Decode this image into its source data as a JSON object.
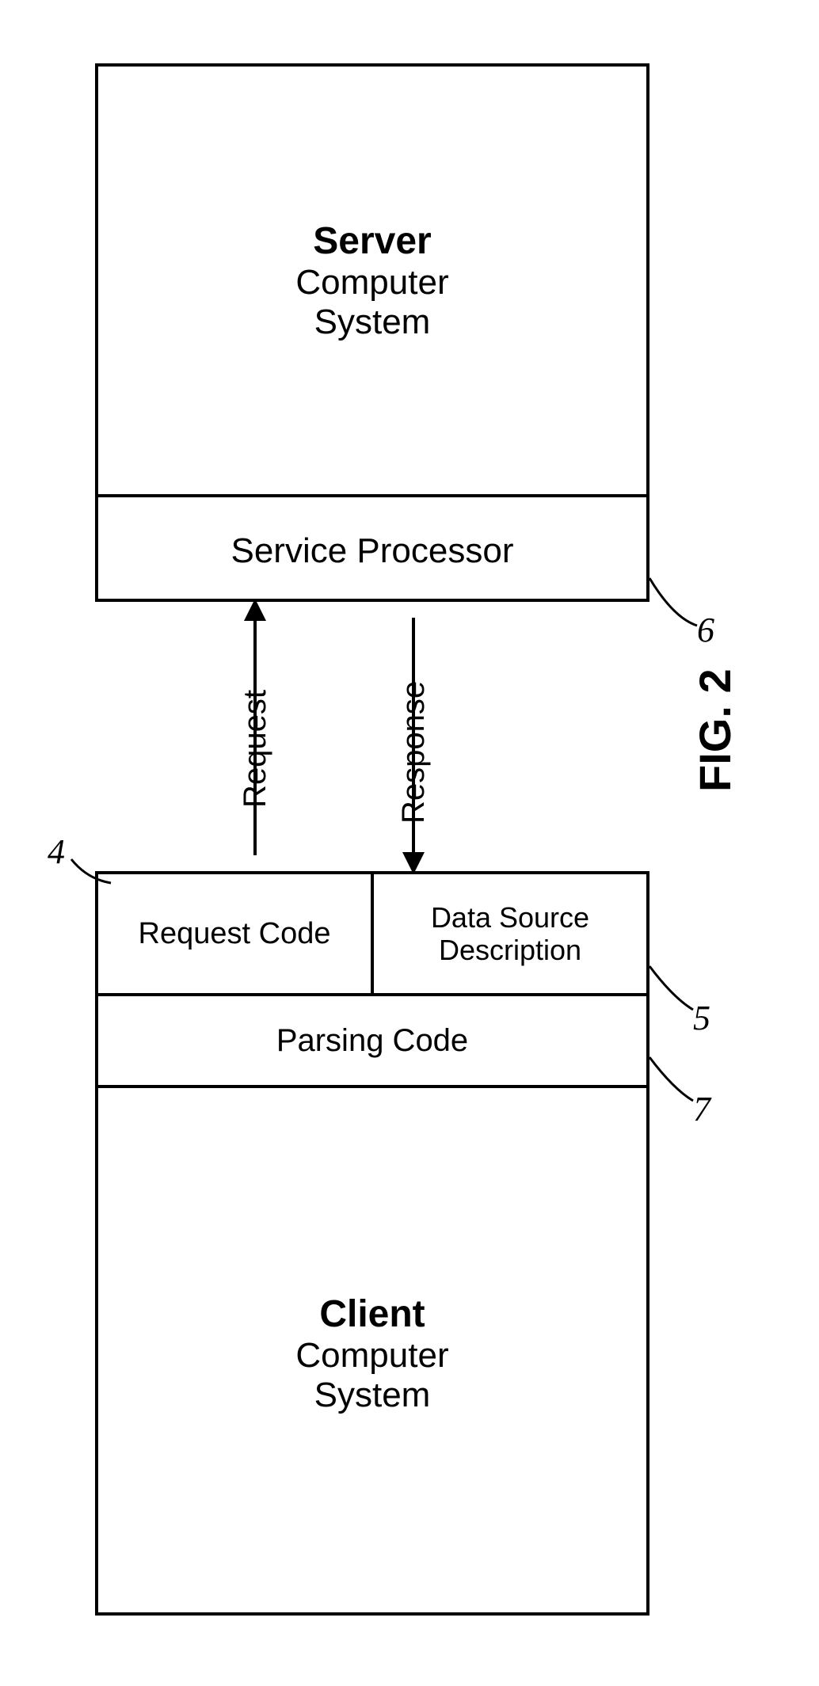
{
  "figure_label": "FIG. 2",
  "server": {
    "title_bold": "Server",
    "title_line1": "Computer",
    "title_line2": "System",
    "service_processor": "Service Processor",
    "ref": "6"
  },
  "client": {
    "title_bold": "Client",
    "title_line1": "Computer",
    "title_line2": "System",
    "request_code": "Request Code",
    "data_source_description": "Data Source\nDescription",
    "parsing_code": "Parsing Code",
    "ref_request_code": "4",
    "ref_dsd": "5",
    "ref_parsing": "7"
  },
  "arrows": {
    "request": "Request",
    "response": "Response"
  }
}
